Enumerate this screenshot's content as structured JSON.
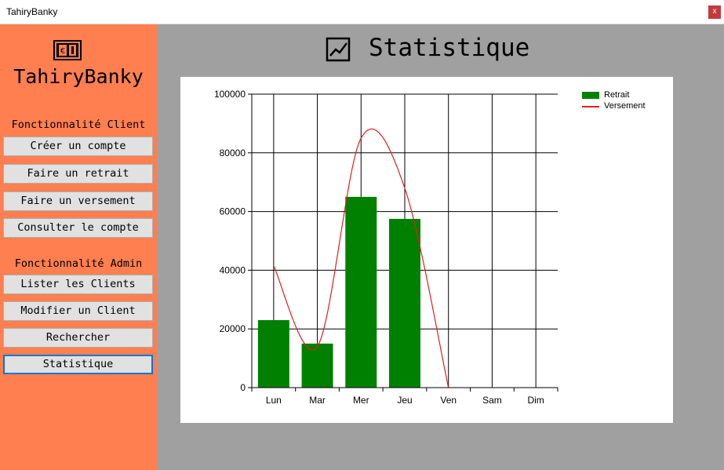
{
  "window": {
    "title": "TahiryBanky",
    "close_label": "x"
  },
  "sidebar": {
    "brand": "TahiryBanky",
    "logo_icon": "money-icon",
    "client_section": "Fonctionnalité Client",
    "client_items": [
      {
        "label": "Créer un compte"
      },
      {
        "label": "Faire un retrait"
      },
      {
        "label": "Faire un versement"
      },
      {
        "label": "Consulter le compte"
      }
    ],
    "admin_section": "Fonctionnalité Admin",
    "admin_items": [
      {
        "label": "Lister les Clients"
      },
      {
        "label": "Modifier un Client"
      },
      {
        "label": "Rechercher"
      },
      {
        "label": "Statistique",
        "active": true
      }
    ]
  },
  "main": {
    "title": "Statistique",
    "title_icon": "line-chart-icon"
  },
  "colors": {
    "sidebar_bg": "#ff7f50",
    "main_bg": "#a0a0a0",
    "bar_color": "#008000",
    "line_color": "#e02020",
    "active_border": "#0078d7"
  },
  "chart_data": {
    "type": "bar",
    "categories": [
      "Lun",
      "Mar",
      "Mer",
      "Jeu",
      "Ven",
      "Sam",
      "Dim"
    ],
    "series": [
      {
        "name": "Retrait",
        "type": "bar",
        "values": [
          23000,
          15000,
          65000,
          57500,
          0,
          0,
          0
        ]
      },
      {
        "name": "Versement",
        "type": "spline",
        "values": [
          41500,
          14000,
          85000,
          68000,
          0,
          null,
          null
        ]
      }
    ],
    "ylim": [
      0,
      100000
    ],
    "yticks": [
      "0",
      "20000",
      "40000",
      "60000",
      "80000",
      "100000"
    ],
    "grid": true,
    "legend": "top-right"
  }
}
